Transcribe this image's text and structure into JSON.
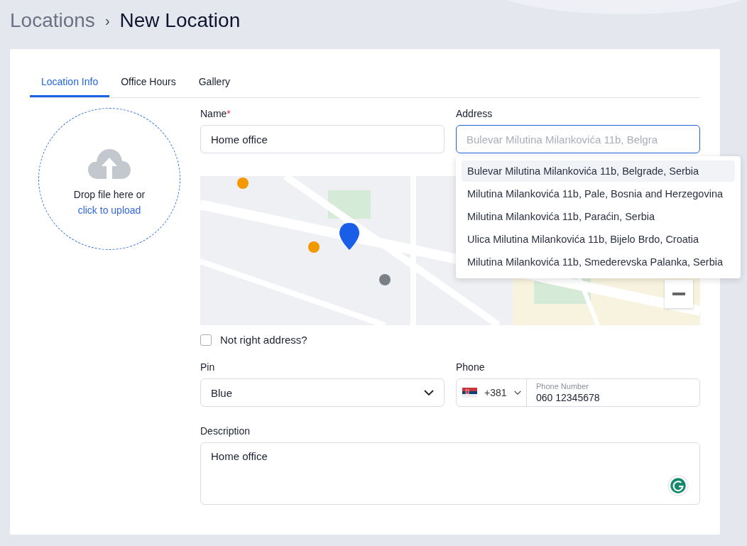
{
  "breadcrumb": {
    "parent": "Locations",
    "separator": "›",
    "current": "New Location"
  },
  "tabs": [
    {
      "label": "Location Info",
      "selected": true
    },
    {
      "label": "Office Hours",
      "selected": false
    },
    {
      "label": "Gallery",
      "selected": false
    }
  ],
  "upload": {
    "text": "Drop file here or",
    "link": "click to upload"
  },
  "name_field": {
    "label": "Name",
    "required_mark": "*",
    "value": "Home office"
  },
  "address_field": {
    "label": "Address",
    "placeholder": "Bulevar Milutina Milankovića 11b, Belgra",
    "focused": true
  },
  "suggestions": [
    {
      "text": "Bulevar Milutina Milankovića 11b, Belgrade, Serbia",
      "selected": true
    },
    {
      "text": "Milutina Milankovića 11b, Pale, Bosnia and Herzegovina",
      "selected": false
    },
    {
      "text": "Milutina Milankovića 11b, Paraćin, Serbia",
      "selected": false
    },
    {
      "text": "Ulica Milutina Milankovića 11b, Bijelo Brdo, Croatia",
      "selected": false
    },
    {
      "text": "Milutina Milankovića 11b, Smederevska Palanka, Serbia",
      "selected": false
    }
  ],
  "not_right_address": {
    "label": "Not right address?",
    "checked": false
  },
  "pin_field": {
    "label": "Pin",
    "value": "Blue"
  },
  "phone_field": {
    "label": "Phone",
    "code": "+381",
    "floating_label": "Phone Number",
    "value": "060 12345678"
  },
  "description_field": {
    "label": "Description",
    "value": "Home office"
  }
}
